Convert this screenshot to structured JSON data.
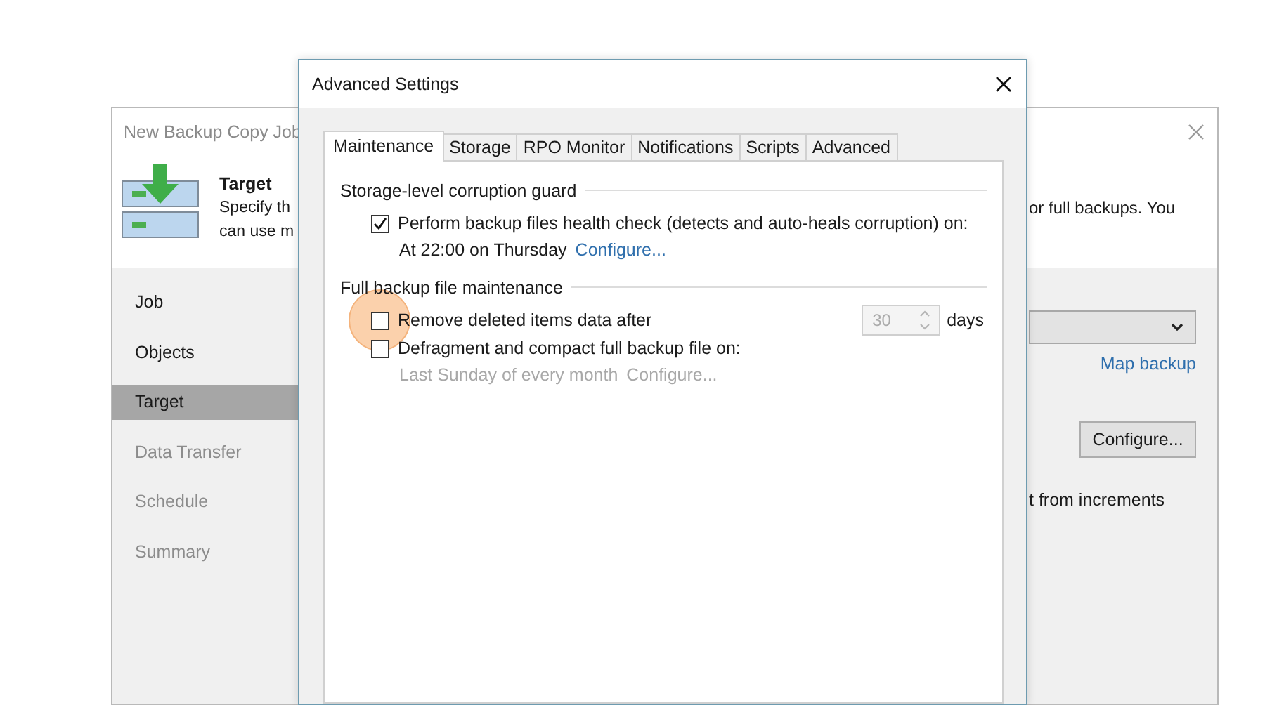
{
  "background_window": {
    "title": "New Backup Copy Job",
    "header": {
      "title": "Target",
      "description_left": [
        "Specify th",
        "can use m"
      ],
      "description_right": [
        "or full backups. You"
      ]
    },
    "steps": [
      {
        "label": "Job",
        "selected": false,
        "disabled": false
      },
      {
        "label": "Objects",
        "selected": false,
        "disabled": false
      },
      {
        "label": "Target",
        "selected": true,
        "disabled": false
      },
      {
        "label": "Data Transfer",
        "selected": false,
        "disabled": true
      },
      {
        "label": "Schedule",
        "selected": false,
        "disabled": true
      },
      {
        "label": "Summary",
        "selected": false,
        "disabled": true
      }
    ],
    "map_backup_link": "Map backup",
    "configure_button": "Configure...",
    "partial_text": "t from increments"
  },
  "dialog": {
    "title": "Advanced Settings",
    "tabs": [
      {
        "label": "Maintenance",
        "selected": true
      },
      {
        "label": "Storage",
        "selected": false
      },
      {
        "label": "RPO Monitor",
        "selected": false
      },
      {
        "label": "Notifications",
        "selected": false
      },
      {
        "label": "Scripts",
        "selected": false
      },
      {
        "label": "Advanced",
        "selected": false
      }
    ],
    "groups": [
      {
        "title": "Storage-level corruption guard",
        "options": [
          {
            "kind": "checkbox",
            "label": "Perform backup files health check (detects and auto-heals corruption) on:",
            "checked": true,
            "highlighted": false,
            "detail": "At 22:00 on Thursday",
            "link": "Configure...",
            "detail_disabled": false
          }
        ]
      },
      {
        "title": "Full backup file maintenance",
        "options": [
          {
            "kind": "checkbox",
            "label": "Remove deleted items data after",
            "checked": false,
            "highlighted": true,
            "spinner": {
              "value": "30",
              "disabled": true
            },
            "unit": "days"
          },
          {
            "kind": "checkbox",
            "label": "Defragment and compact full backup file on:",
            "checked": false,
            "highlighted": false,
            "detail": "Last Sunday of every month",
            "link": "Configure...",
            "detail_disabled": true
          }
        ]
      }
    ]
  }
}
